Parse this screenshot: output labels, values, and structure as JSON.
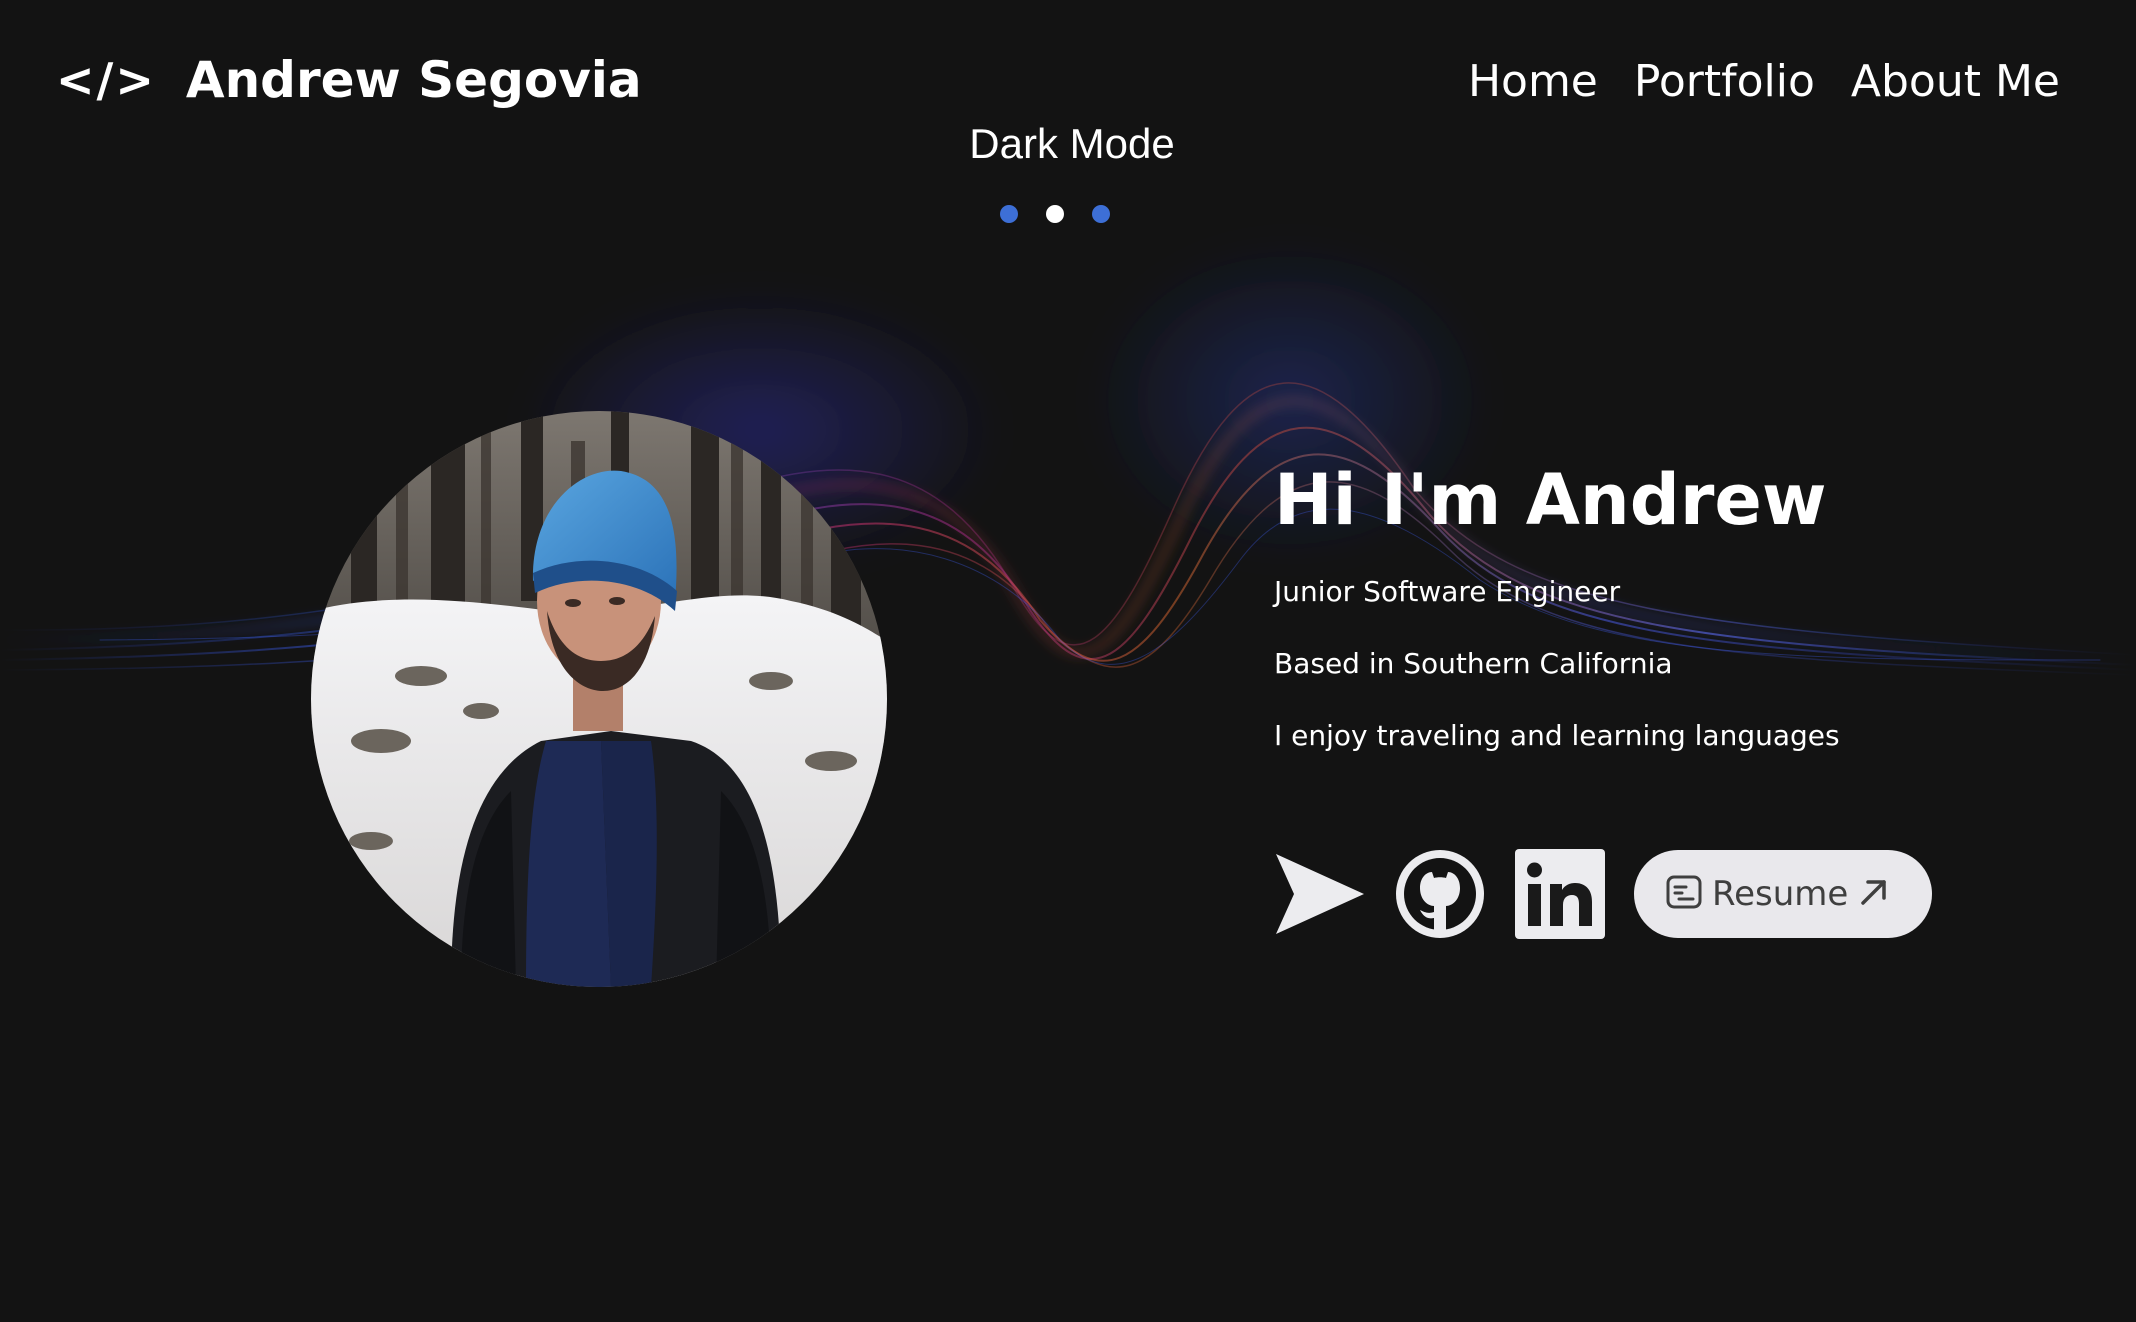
{
  "brand": {
    "icon_text": "</>",
    "name": "Andrew Segovia"
  },
  "nav": {
    "items": [
      {
        "label": "Home"
      },
      {
        "label": "Portfolio"
      },
      {
        "label": "About Me"
      }
    ]
  },
  "theme_switch": {
    "label": "Dark Mode",
    "options": [
      {
        "name": "option-1",
        "color": "#3d6fd6",
        "active": false
      },
      {
        "name": "option-2",
        "color": "#ffffff",
        "active": true
      },
      {
        "name": "option-3",
        "color": "#3d6fd6",
        "active": false
      }
    ]
  },
  "hero": {
    "title": "Hi I'm Andrew",
    "lines": [
      "Junior Software Engineer",
      "Based in Southern California",
      "I enjoy traveling and learning languages"
    ]
  },
  "social": {
    "icons": [
      "send-icon",
      "github-icon",
      "linkedin-icon"
    ],
    "resume_label": "Resume"
  },
  "colors": {
    "background": "#131313",
    "text": "#ffffff",
    "accent_blue": "#3d6fd6",
    "resume_bg": "#e9e8ec"
  }
}
